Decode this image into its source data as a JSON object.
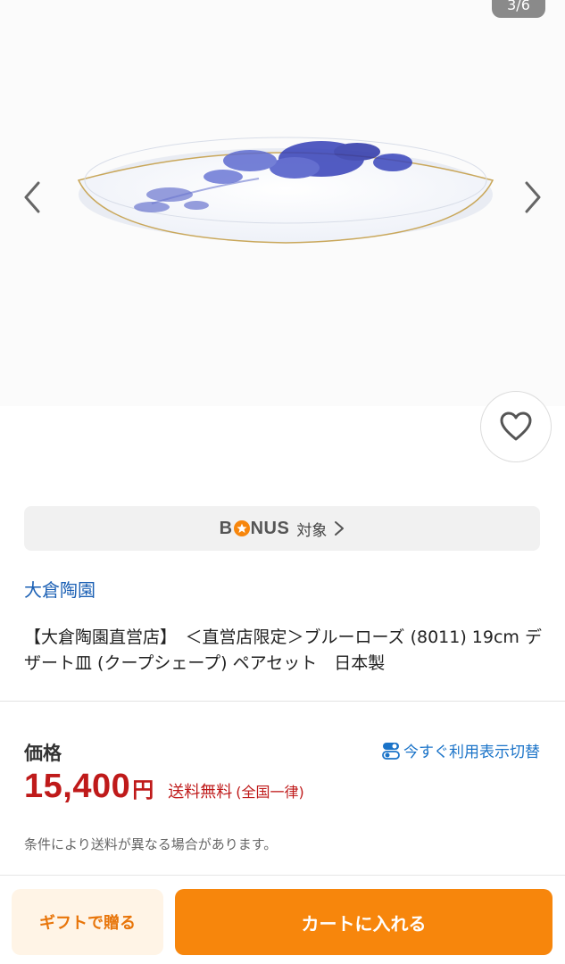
{
  "gallery": {
    "counter": "3/6",
    "prev_icon": "chevron-left-icon",
    "next_icon": "chevron-right-icon",
    "favorite_icon": "heart-icon"
  },
  "bonus": {
    "logo_text_before": "B",
    "logo_text_after": "NUS",
    "label": "対象"
  },
  "shop": {
    "name": "大倉陶園"
  },
  "product": {
    "title": "【大倉陶園直営店】　＜直営店限定＞ブルーローズ (8011) 19cm デザート皿 (クープシェープ) ペアセット　日本製"
  },
  "price": {
    "label": "価格",
    "switch_link": "今すぐ利用表示切替",
    "value": "15,400",
    "currency": "円",
    "shipping": "送料無料",
    "shipping_note": "(全国一律)",
    "note": "条件により送料が異なる場合があります。"
  },
  "actions": {
    "gift": "ギフトで贈る",
    "cart": "カートに入れる"
  },
  "colors": {
    "accent": "#f7860c",
    "price": "#bf1a1a",
    "link": "#1a5fb4"
  }
}
